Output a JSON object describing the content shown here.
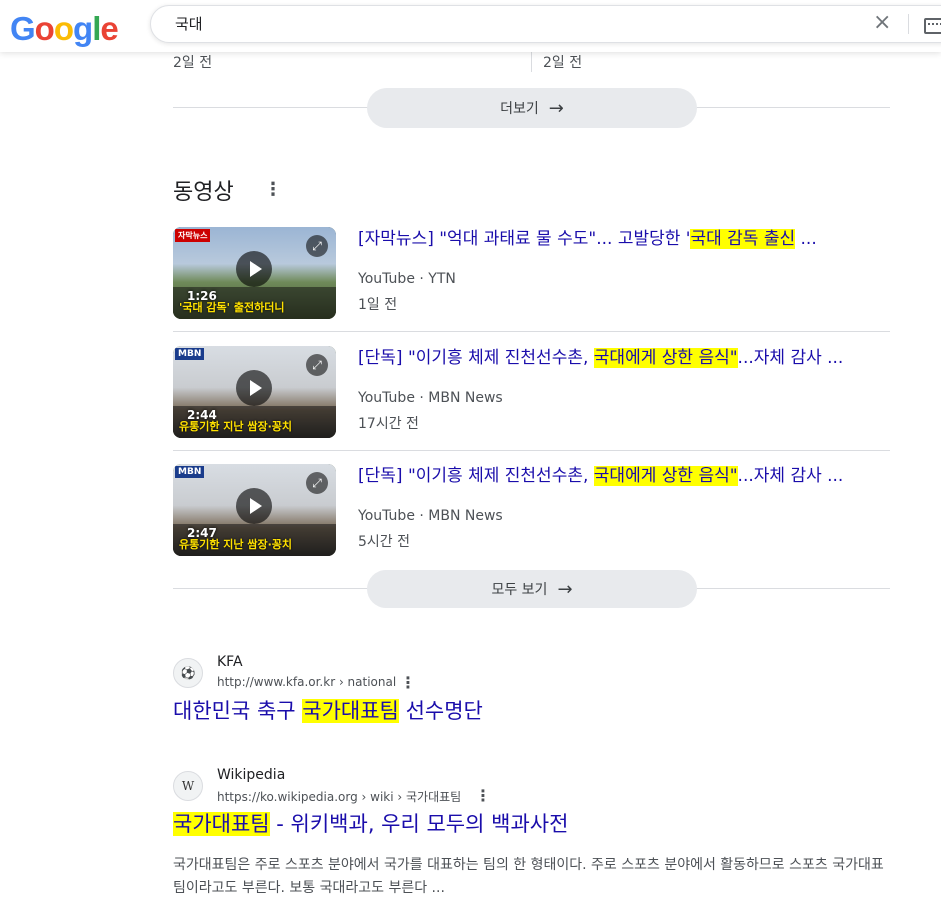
{
  "header": {
    "logo": [
      "G",
      "o",
      "o",
      "g",
      "l",
      "e"
    ],
    "search_value": "국대",
    "clear_icon": "×"
  },
  "news_dates": [
    "2일 전",
    "2일 전"
  ],
  "more_button": "더보기",
  "videos_section": {
    "title": "동영상",
    "items": [
      {
        "title_pre": "[자막뉴스] \"억대 과태료 물 수도\"... 고발당한 '",
        "title_hl": "국대 감독 출신",
        "title_post": " ...",
        "source": "YouTube · YTN",
        "date": "1일 전",
        "duration": "1:26",
        "thumb_tag": "자막뉴스",
        "thumb_caption": "'국대 감독' 출전하더니"
      },
      {
        "title_pre": "[단독] \"이기흥 체제 진천선수촌, ",
        "title_hl": "국대에게 상한 음식\"",
        "title_post": "...자체 감사 ...",
        "source": "YouTube · MBN News",
        "date": "17시간 전",
        "duration": "2:44",
        "thumb_tag": "MBN",
        "thumb_caption": "유통기한 지난 쌈장·꽁치"
      },
      {
        "title_pre": "[단독] \"이기흥 체제 진천선수촌, ",
        "title_hl": "국대에게 상한 음식\"",
        "title_post": "...자체 감사 ...",
        "source": "YouTube · MBN News",
        "date": "5시간 전",
        "duration": "2:47",
        "thumb_tag": "MBN",
        "thumb_caption": "유통기한 지난 쌈장·꽁치"
      }
    ],
    "see_all": "모두 보기"
  },
  "results": [
    {
      "favicon": "⚽",
      "site": "KFA",
      "url": "http://www.kfa.or.kr › national",
      "title_pre": "대한민국 축구 ",
      "title_hl": "국가대표팀",
      "title_post": " 선수명단"
    },
    {
      "favicon": "W",
      "site": "Wikipedia",
      "url": "https://ko.wikipedia.org › wiki › 국가대표팀",
      "title_pre": "",
      "title_hl": "국가대표팀",
      "title_post": " - 위키백과, 우리 모두의 백과사전",
      "snippet": "국가대표팀은 주로 스포츠 분야에서 국가를 대표하는 팀의 한 형태이다. 주로 스포츠 분야에서 활동하므로 스포츠 국가대표팀이라고도 부른다. 보통 국대라고도 부른다 ..."
    }
  ]
}
